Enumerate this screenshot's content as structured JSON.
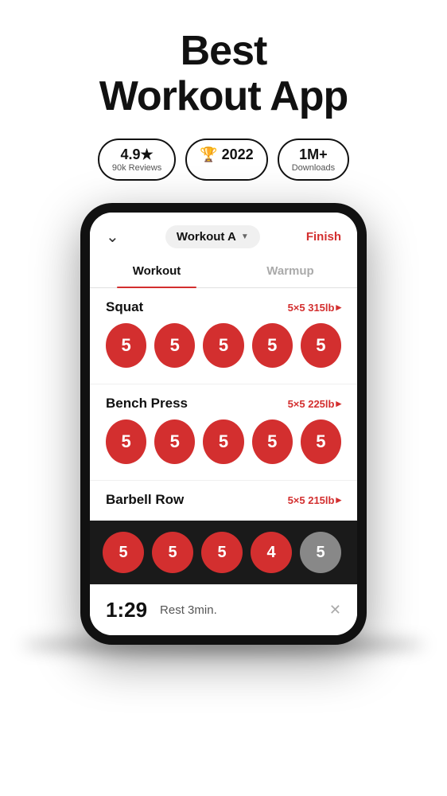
{
  "header": {
    "title_line1": "Best",
    "title_line2": "Workout App"
  },
  "badges": [
    {
      "main": "4.9★",
      "sub": "90k Reviews"
    },
    {
      "main": "🏆 2022",
      "sub": ""
    },
    {
      "main": "1M+",
      "sub": "Downloads"
    }
  ],
  "phone": {
    "workout_name": "Workout A",
    "finish_label": "Finish",
    "tabs": [
      {
        "label": "Workout",
        "active": true
      },
      {
        "label": "Warmup",
        "active": false
      }
    ],
    "exercises": [
      {
        "name": "Squat",
        "info": "5×5 315lb",
        "sets": [
          5,
          5,
          5,
          5,
          5
        ],
        "grey": []
      },
      {
        "name": "Bench Press",
        "info": "5×5 225lb",
        "sets": [
          5,
          5,
          5,
          5,
          5
        ],
        "grey": []
      },
      {
        "name": "Barbell Row",
        "info": "5×5 215lb",
        "sets": [],
        "grey": []
      }
    ],
    "bottom_sets": [
      5,
      5,
      5,
      4,
      5
    ],
    "bottom_grey_index": 4,
    "rest_timer": {
      "time": "1:29",
      "label": "Rest 3min."
    }
  }
}
